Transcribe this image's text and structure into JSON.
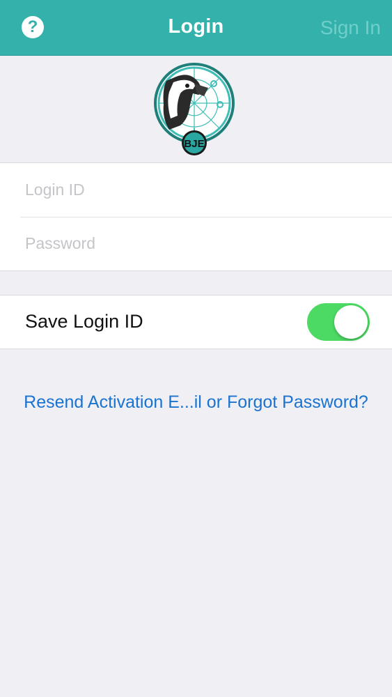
{
  "navbar": {
    "help_label": "?",
    "title": "Login",
    "sign_in_label": "Sign In",
    "bar_color": "#34b1ab"
  },
  "logo": {
    "text": "BJE"
  },
  "form": {
    "login_id_placeholder": "Login ID",
    "login_id_value": "",
    "password_placeholder": "Password",
    "password_value": ""
  },
  "save_login": {
    "label": "Save Login ID",
    "enabled": true,
    "toggle_color": "#4cd964"
  },
  "link": {
    "text": "Resend Activation E...il or Forgot Password?",
    "color": "#1a73d1"
  }
}
